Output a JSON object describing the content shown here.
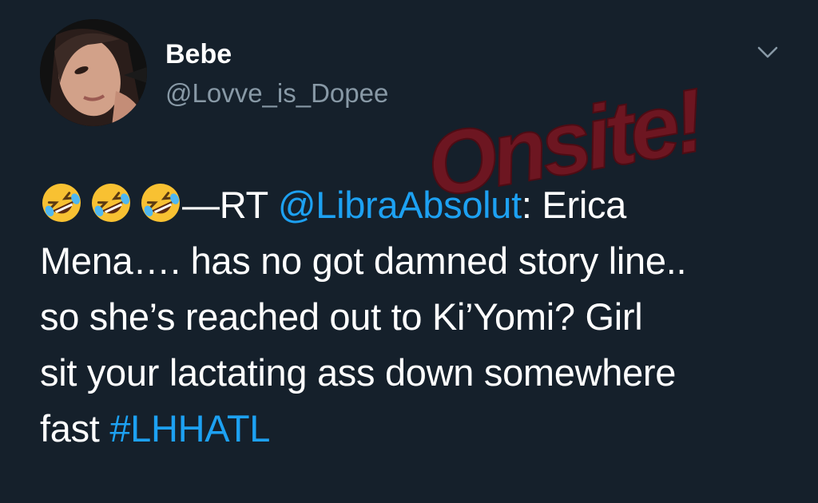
{
  "tweet": {
    "author": {
      "display_name": "Bebe",
      "handle": "@Lovve_is_Dopee"
    },
    "menu_icon": "chevron-down-icon",
    "emoji": [
      "rolling-on-floor-laughing-emoji",
      "rolling-on-floor-laughing-emoji",
      "rolling-on-floor-laughing-emoji"
    ],
    "line1": {
      "prefix": "—RT ",
      "mention": "@LibraAbsolut",
      "suffix": ": Erica"
    },
    "line2": "Mena…. has no got damned story line..",
    "line3": "so she’s reached out to Ki’Yomi? Girl",
    "line4": "sit your lactating ass down somewhere",
    "line5": {
      "text": "fast ",
      "hashtag": "#LHHATL"
    },
    "watermark_text": "Onsite!"
  },
  "colors": {
    "background": "#15202b",
    "text": "#ffffff",
    "secondary_text": "#8899a6",
    "link": "#1da1f2",
    "watermark": "#7a1420"
  }
}
